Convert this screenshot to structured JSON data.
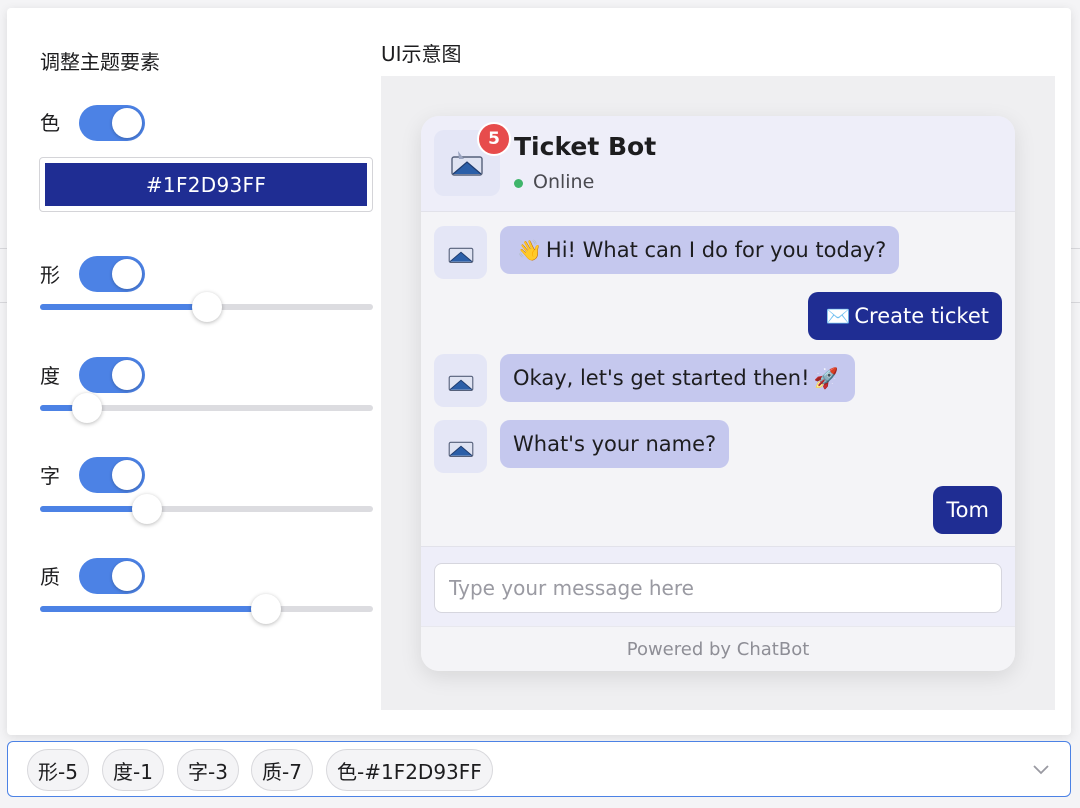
{
  "panel": {
    "controls_title": "调整主题要素",
    "preview_title": "UI示意图",
    "controls": {
      "color": {
        "label": "色",
        "enabled": true,
        "value": "#1F2D93FF"
      },
      "shape": {
        "label": "形",
        "enabled": true,
        "slider_fraction": 0.5
      },
      "degree": {
        "label": "度",
        "enabled": true,
        "slider_fraction": 0.14
      },
      "font": {
        "label": "字",
        "enabled": true,
        "slider_fraction": 0.32
      },
      "texture": {
        "label": "质",
        "enabled": true,
        "slider_fraction": 0.68
      }
    }
  },
  "chat": {
    "bot_name": "Ticket Bot",
    "badge_count": "5",
    "status": "Online",
    "messages": [
      {
        "from": "bot",
        "emoji": "👋",
        "text": "Hi! What can I do for you today?"
      },
      {
        "from": "user",
        "emoji": "✉️",
        "text": "Create ticket"
      },
      {
        "from": "bot",
        "text": "Okay, let's get started then!",
        "emoji": "🚀"
      },
      {
        "from": "bot",
        "text": "What's your name?"
      },
      {
        "from": "user",
        "text": "Tom"
      }
    ],
    "input_placeholder": "Type your message here",
    "footer": "Powered by ChatBot"
  },
  "tags": [
    "形-5",
    "度-1",
    "字-3",
    "质-7",
    "色-#1F2D93FF"
  ],
  "colors": {
    "accent": "#4c82e5",
    "theme": "#1F2D93",
    "bot_bubble": "#c5c8ee",
    "badge": "#e74c4c"
  },
  "icons": {
    "bot_avatar": "envelope-icon",
    "dropdown": "chevron-down-icon"
  }
}
